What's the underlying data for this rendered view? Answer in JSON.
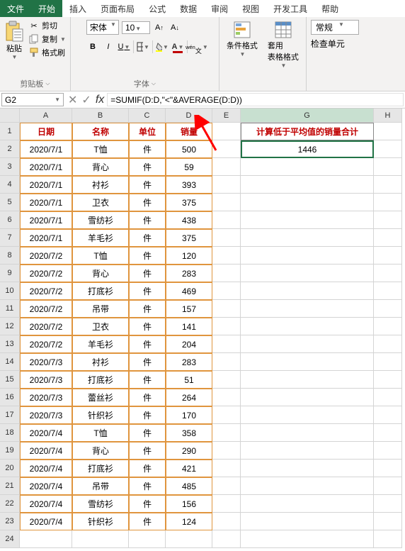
{
  "tabs": {
    "file": "文件",
    "home": "开始",
    "insert": "插入",
    "layout": "页面布局",
    "formula": "公式",
    "data": "数据",
    "review": "审阅",
    "view": "视图",
    "dev": "开发工具",
    "help": "帮助"
  },
  "ribbon": {
    "paste": "粘贴",
    "cut": "剪切",
    "copy": "复制",
    "fmtpaint": "格式刷",
    "clipboard_label": "剪贴板",
    "font_name": "宋体",
    "font_size": "10",
    "font_label": "字体",
    "cond": "条件格式",
    "table": "套用\n表格格式",
    "num_general": "常规",
    "num_label": "检查单元"
  },
  "namebox": "G2",
  "formula": "=SUMIF(D:D,\"<\"&AVERAGE(D:D))",
  "cols": [
    "A",
    "B",
    "C",
    "D",
    "E",
    "G",
    "H"
  ],
  "headers": {
    "date": "日期",
    "name": "名称",
    "unit": "单位",
    "sales": "销量"
  },
  "g_title": "计算低于平均值的销量合计",
  "g_value": "1446",
  "rows": [
    {
      "d": "2020/7/1",
      "n": "T恤",
      "u": "件",
      "s": "500"
    },
    {
      "d": "2020/7/1",
      "n": "背心",
      "u": "件",
      "s": "59"
    },
    {
      "d": "2020/7/1",
      "n": "衬衫",
      "u": "件",
      "s": "393"
    },
    {
      "d": "2020/7/1",
      "n": "卫衣",
      "u": "件",
      "s": "375"
    },
    {
      "d": "2020/7/1",
      "n": "雪纺衫",
      "u": "件",
      "s": "438"
    },
    {
      "d": "2020/7/1",
      "n": "羊毛衫",
      "u": "件",
      "s": "375"
    },
    {
      "d": "2020/7/2",
      "n": "T恤",
      "u": "件",
      "s": "120"
    },
    {
      "d": "2020/7/2",
      "n": "背心",
      "u": "件",
      "s": "283"
    },
    {
      "d": "2020/7/2",
      "n": "打底衫",
      "u": "件",
      "s": "469"
    },
    {
      "d": "2020/7/2",
      "n": "吊带",
      "u": "件",
      "s": "157"
    },
    {
      "d": "2020/7/2",
      "n": "卫衣",
      "u": "件",
      "s": "141"
    },
    {
      "d": "2020/7/2",
      "n": "羊毛衫",
      "u": "件",
      "s": "204"
    },
    {
      "d": "2020/7/3",
      "n": "衬衫",
      "u": "件",
      "s": "283"
    },
    {
      "d": "2020/7/3",
      "n": "打底衫",
      "u": "件",
      "s": "51"
    },
    {
      "d": "2020/7/3",
      "n": "蕾丝衫",
      "u": "件",
      "s": "264"
    },
    {
      "d": "2020/7/3",
      "n": "针织衫",
      "u": "件",
      "s": "170"
    },
    {
      "d": "2020/7/4",
      "n": "T恤",
      "u": "件",
      "s": "358"
    },
    {
      "d": "2020/7/4",
      "n": "背心",
      "u": "件",
      "s": "290"
    },
    {
      "d": "2020/7/4",
      "n": "打底衫",
      "u": "件",
      "s": "421"
    },
    {
      "d": "2020/7/4",
      "n": "吊带",
      "u": "件",
      "s": "485"
    },
    {
      "d": "2020/7/4",
      "n": "雪纺衫",
      "u": "件",
      "s": "156"
    },
    {
      "d": "2020/7/4",
      "n": "针织衫",
      "u": "件",
      "s": "124"
    }
  ],
  "chart_data": {
    "type": "table",
    "title": "计算低于平均值的销量合计",
    "columns": [
      "日期",
      "名称",
      "单位",
      "销量"
    ],
    "rows": [
      [
        "2020/7/1",
        "T恤",
        "件",
        500
      ],
      [
        "2020/7/1",
        "背心",
        "件",
        59
      ],
      [
        "2020/7/1",
        "衬衫",
        "件",
        393
      ],
      [
        "2020/7/1",
        "卫衣",
        "件",
        375
      ],
      [
        "2020/7/1",
        "雪纺衫",
        "件",
        438
      ],
      [
        "2020/7/1",
        "羊毛衫",
        "件",
        375
      ],
      [
        "2020/7/2",
        "T恤",
        "件",
        120
      ],
      [
        "2020/7/2",
        "背心",
        "件",
        283
      ],
      [
        "2020/7/2",
        "打底衫",
        "件",
        469
      ],
      [
        "2020/7/2",
        "吊带",
        "件",
        157
      ],
      [
        "2020/7/2",
        "卫衣",
        "件",
        141
      ],
      [
        "2020/7/2",
        "羊毛衫",
        "件",
        204
      ],
      [
        "2020/7/3",
        "衬衫",
        "件",
        283
      ],
      [
        "2020/7/3",
        "打底衫",
        "件",
        51
      ],
      [
        "2020/7/3",
        "蕾丝衫",
        "件",
        264
      ],
      [
        "2020/7/3",
        "针织衫",
        "件",
        170
      ],
      [
        "2020/7/4",
        "T恤",
        "件",
        358
      ],
      [
        "2020/7/4",
        "背心",
        "件",
        290
      ],
      [
        "2020/7/4",
        "打底衫",
        "件",
        421
      ],
      [
        "2020/7/4",
        "吊带",
        "件",
        485
      ],
      [
        "2020/7/4",
        "雪纺衫",
        "件",
        156
      ],
      [
        "2020/7/4",
        "针织衫",
        "件",
        124
      ]
    ],
    "formula": "=SUMIF(D:D,\"<\"&AVERAGE(D:D))",
    "result": 1446
  }
}
